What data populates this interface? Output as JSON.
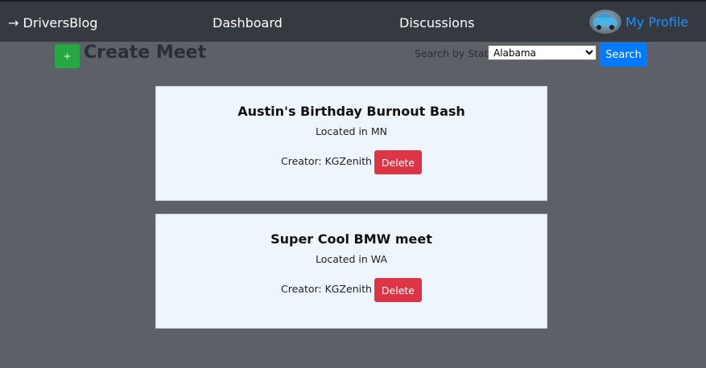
{
  "navbar": {
    "brand": "→ DriversBlog",
    "links": [
      {
        "label": "Dashboard"
      },
      {
        "label": "Discussions"
      }
    ],
    "profile_label": "My Profile"
  },
  "toolbar": {
    "create_button_label": "+",
    "page_title": "Create Meet",
    "search_label": "Search by State",
    "state_selected": "Alabama",
    "search_button_label": "Search"
  },
  "meets": [
    {
      "title": "Austin's Birthday Burnout Bash",
      "location": "Located in MN",
      "creator": "Creator: KGZenith",
      "delete_label": "Delete"
    },
    {
      "title": "Super Cool BMW meet",
      "location": "Located in WA",
      "creator": "Creator: KGZenith",
      "delete_label": "Delete"
    }
  ],
  "colors": {
    "navbar_bg": "#343a40",
    "page_bg": "#5d6066",
    "card_bg": "#eef6fc",
    "create_green": "#28a745",
    "search_blue": "#007bff",
    "delete_red": "#dc3545",
    "profile_link": "#1e90ff"
  },
  "icons": {
    "profile_avatar": "car-avatar-icon"
  }
}
